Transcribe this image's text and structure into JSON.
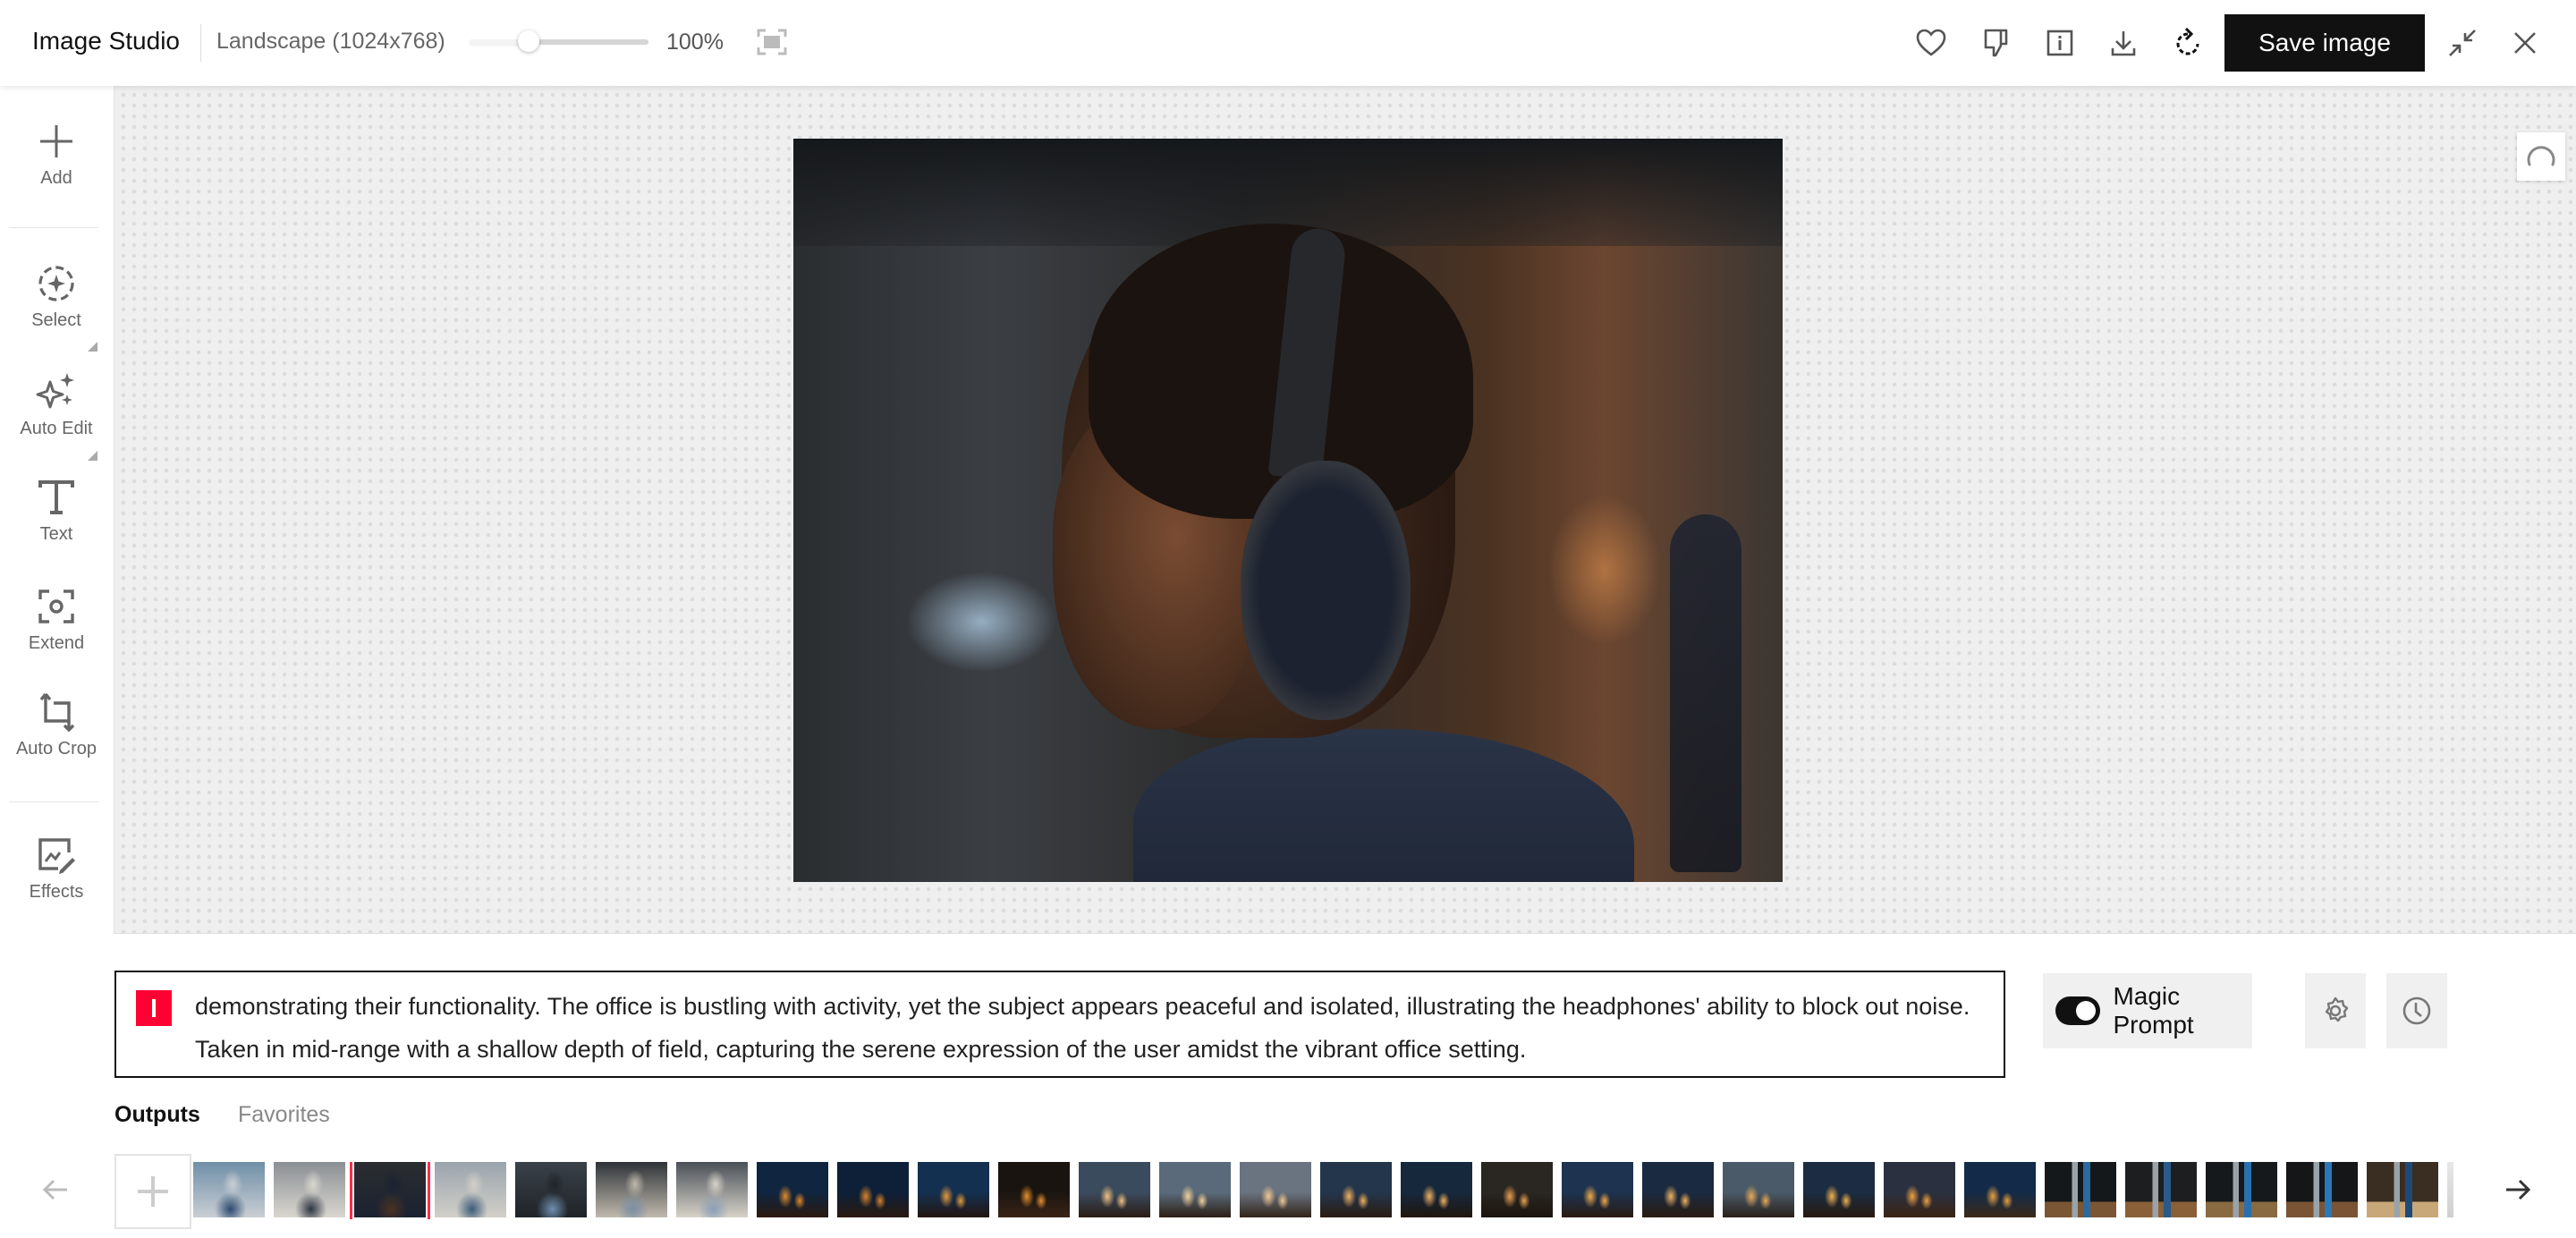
{
  "header": {
    "app_title": "Image Studio",
    "size_label": "Landscape (1024x768)",
    "zoom_slider_fraction": 0.33,
    "zoom_percent": "100%",
    "save_label": "Save image",
    "icons": [
      "heart-icon",
      "thumbs-down-icon",
      "info-icon",
      "download-icon",
      "regenerate-icon",
      "collapse-icon",
      "close-icon"
    ]
  },
  "toolbar": {
    "items": [
      {
        "label": "Add",
        "icon": "plus-icon"
      },
      {
        "label": "Select",
        "icon": "select-sparkle-icon"
      },
      {
        "label": "Auto Edit",
        "icon": "sparkles-icon"
      },
      {
        "label": "Text",
        "icon": "text-icon"
      },
      {
        "label": "Extend",
        "icon": "extend-icon"
      },
      {
        "label": "Auto Crop",
        "icon": "crop-icon"
      },
      {
        "label": "Effects",
        "icon": "effects-icon"
      }
    ]
  },
  "prompt": {
    "badge_color": "#ff0033",
    "text": "demonstrating their functionality. The office is bustling with activity, yet the subject appears peaceful and isolated, illustrating the headphones' ability to block out noise. Taken in mid-range with a shallow depth of field, capturing the serene expression of the user amidst the vibrant office setting.",
    "magic_prompt_label": "Magic Prompt",
    "magic_prompt_on": true
  },
  "tabs": [
    {
      "label": "Outputs",
      "active": true
    },
    {
      "label": "Favorites",
      "active": false
    }
  ],
  "strip": {
    "selected_index": 2,
    "selected_color": "#ff2a4a",
    "thumbnails": [
      {
        "subject": "man-headphones-office",
        "palette": [
          "#6f8fa8",
          "#2b4a6e",
          "#c9ced3"
        ]
      },
      {
        "subject": "man-headphones-office",
        "palette": [
          "#8a8f94",
          "#2c3440",
          "#d9d6cf"
        ]
      },
      {
        "subject": "man-headphones-office-dark",
        "palette": [
          "#2a2d30",
          "#4a3222",
          "#1b2231"
        ]
      },
      {
        "subject": "man-headphones-office",
        "palette": [
          "#9aa4ad",
          "#3b5b78",
          "#d2cfc8"
        ]
      },
      {
        "subject": "man-headphones-office",
        "palette": [
          "#3a4148",
          "#6f8fb0",
          "#1f2429"
        ]
      },
      {
        "subject": "man-headphones-office",
        "palette": [
          "#2e3338",
          "#7a8fa5",
          "#c0b9ad"
        ]
      },
      {
        "subject": "man-headphones-office",
        "palette": [
          "#4a5058",
          "#8aa0b8",
          "#d6d2c8"
        ]
      },
      {
        "subject": "candles-window",
        "palette": [
          "#0f2540",
          "#e08a2a",
          "#2a1a0e"
        ]
      },
      {
        "subject": "candles-window",
        "palette": [
          "#0d2038",
          "#d9822a",
          "#2a1a10"
        ]
      },
      {
        "subject": "candles-window",
        "palette": [
          "#133050",
          "#e39a3a",
          "#241510"
        ]
      },
      {
        "subject": "candles-window",
        "palette": [
          "#1a1410",
          "#e2902e",
          "#3a2416"
        ]
      },
      {
        "subject": "candles-window",
        "palette": [
          "#3b4b5e",
          "#f0c080",
          "#2a1c14"
        ]
      },
      {
        "subject": "candles-window",
        "palette": [
          "#5a6a7a",
          "#f2d09a",
          "#2d1f16"
        ]
      },
      {
        "subject": "candles-window",
        "palette": [
          "#6a7380",
          "#f0c890",
          "#32241a"
        ]
      },
      {
        "subject": "candles-window",
        "palette": [
          "#24364c",
          "#f0b060",
          "#2a1c12"
        ]
      },
      {
        "subject": "candles-window",
        "palette": [
          "#16283c",
          "#efb060",
          "#21160f"
        ]
      },
      {
        "subject": "candles-window",
        "palette": [
          "#2a2622",
          "#e8a050",
          "#1c140e"
        ]
      },
      {
        "subject": "candles-window",
        "palette": [
          "#1d3350",
          "#f0a848",
          "#2a1a12"
        ]
      },
      {
        "subject": "candles-window",
        "palette": [
          "#1a2a40",
          "#eeb060",
          "#2a1c12"
        ]
      },
      {
        "subject": "candles-window",
        "palette": [
          "#4a5a68",
          "#e8a858",
          "#2a2018"
        ]
      },
      {
        "subject": "candles-window",
        "palette": [
          "#1c2c42",
          "#f0b050",
          "#281a10"
        ]
      },
      {
        "subject": "candles-window",
        "palette": [
          "#2a3040",
          "#f0a040",
          "#3a2414"
        ]
      },
      {
        "subject": "candles-window",
        "palette": [
          "#132a48",
          "#e8a040",
          "#3a2a1a"
        ]
      },
      {
        "subject": "water-bottles",
        "palette": [
          "#15181b",
          "#2a6aa0",
          "#7a5634"
        ]
      },
      {
        "subject": "water-bottles",
        "palette": [
          "#1c1e20",
          "#2a5a8a",
          "#8a6038"
        ]
      },
      {
        "subject": "water-bottles",
        "palette": [
          "#16191c",
          "#2a70b0",
          "#8a6a40"
        ]
      },
      {
        "subject": "water-bottles",
        "palette": [
          "#141618",
          "#2a78b8",
          "#7a5434"
        ]
      },
      {
        "subject": "water-bottles",
        "palette": [
          "#3a2e22",
          "#1e4a78",
          "#c8a878"
        ]
      },
      {
        "subject": "partial",
        "palette": [
          "#e8e8e8",
          "#cfcfcf",
          "#bdbdbd"
        ]
      }
    ]
  }
}
